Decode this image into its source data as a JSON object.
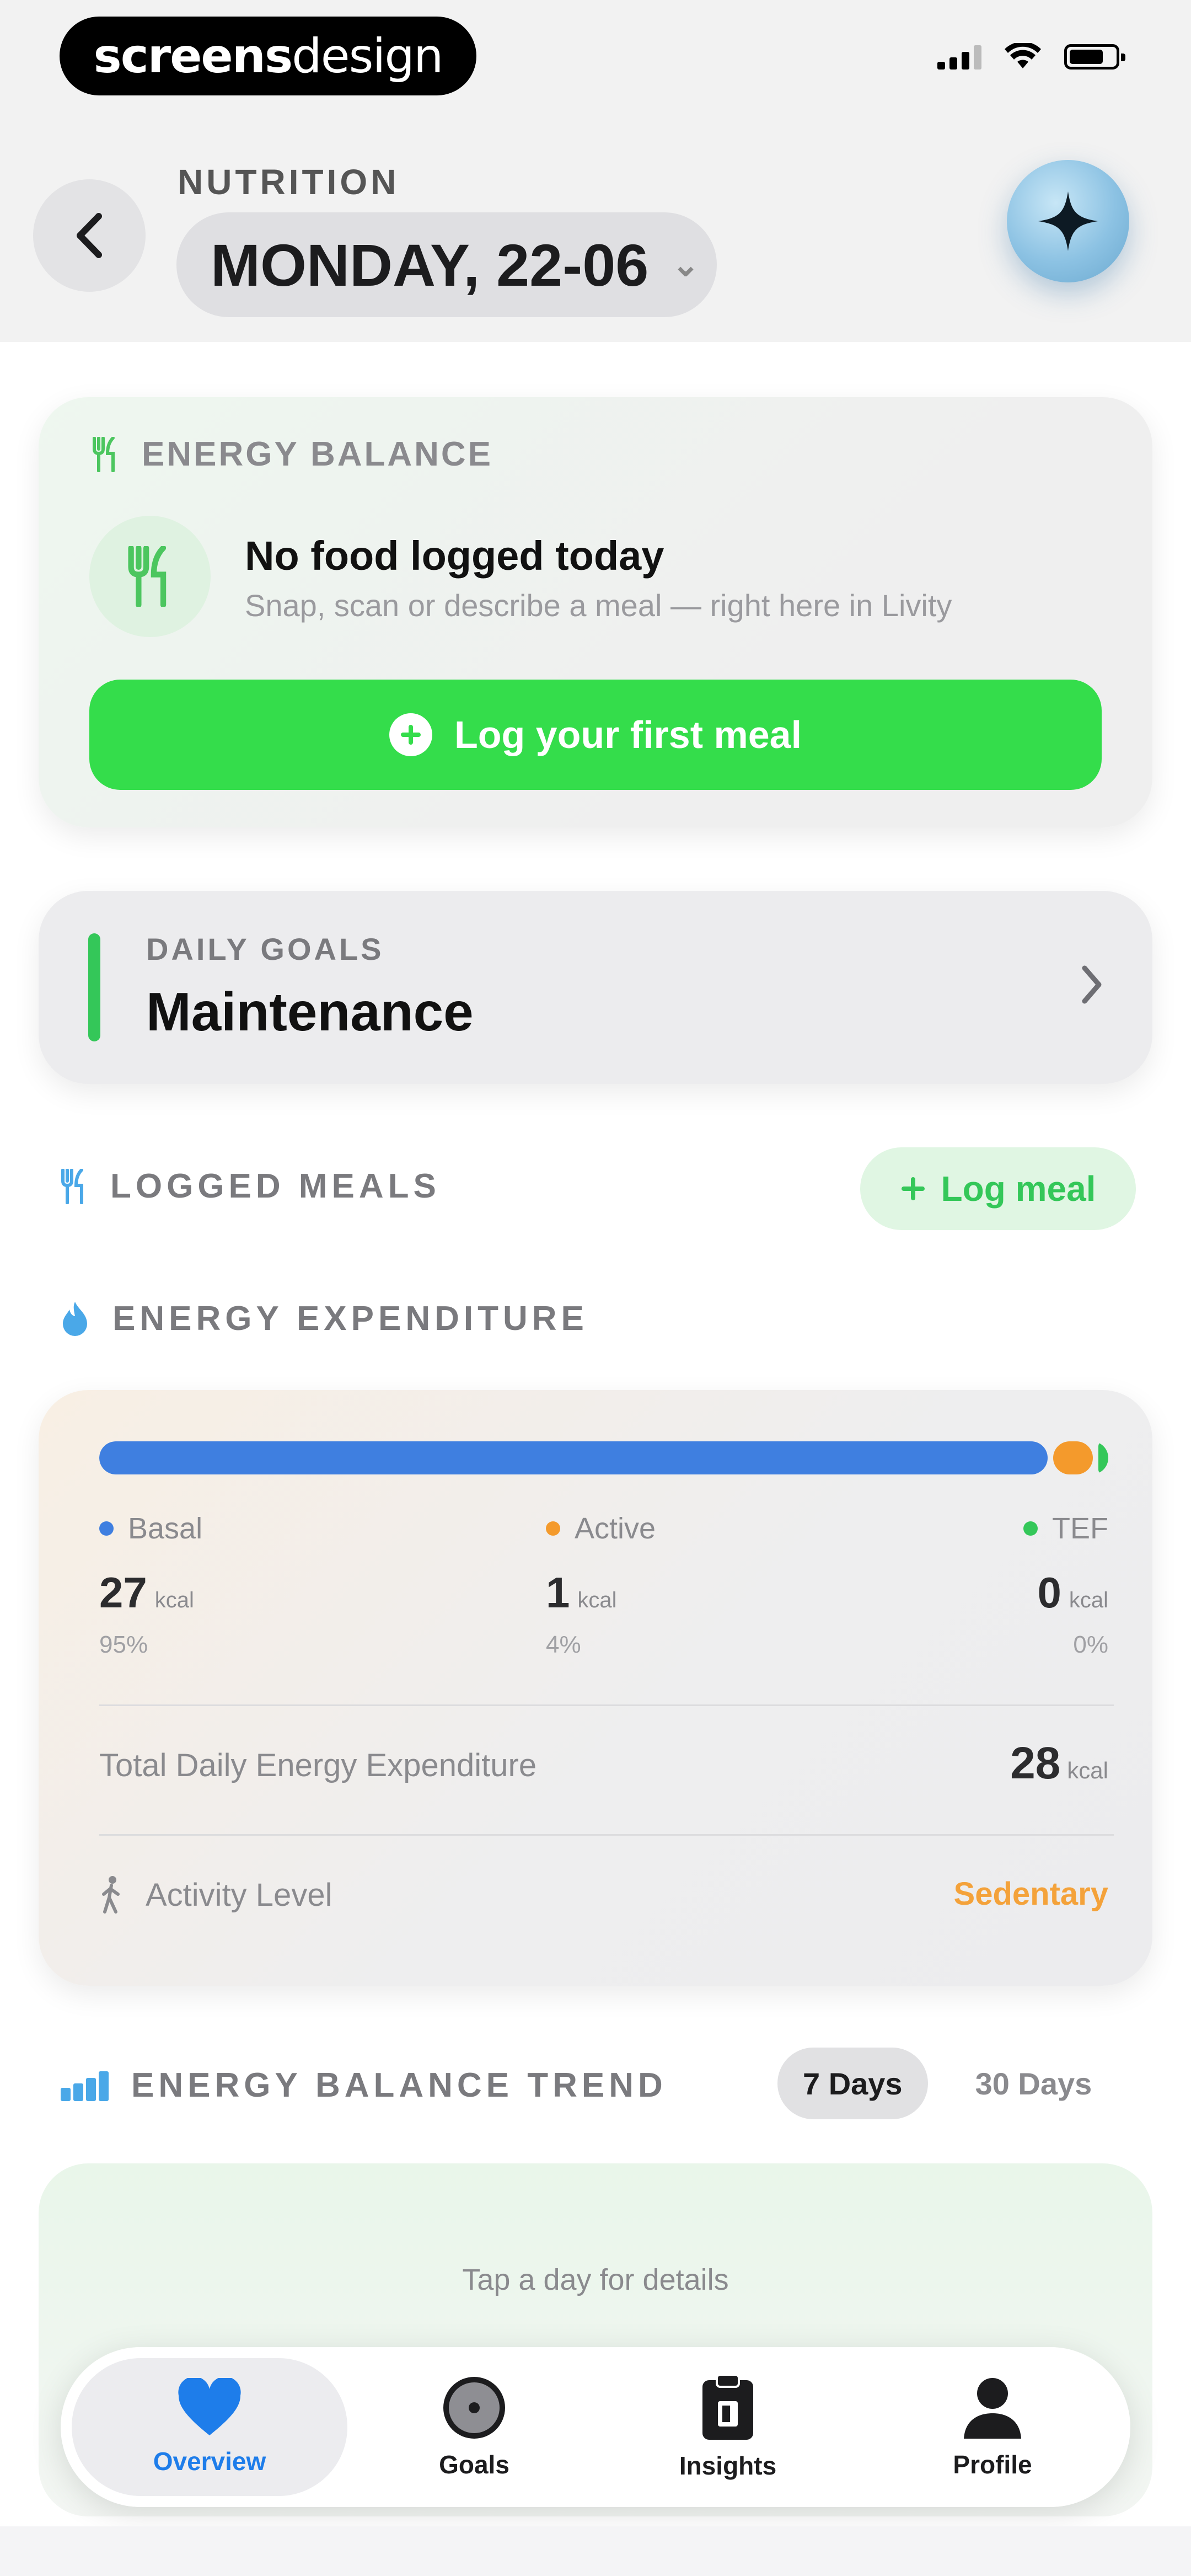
{
  "status_bar": {
    "brand_bold": "screens",
    "brand_light": "design"
  },
  "header": {
    "subtitle": "NUTRITION",
    "date": "MONDAY, 22-06"
  },
  "energy_balance": {
    "label": "ENERGY BALANCE",
    "title": "No food logged today",
    "subtitle": "Snap, scan or describe a meal — right here in Livity",
    "button_label": "Log your first meal"
  },
  "daily_goals": {
    "label": "DAILY GOALS",
    "value": "Maintenance"
  },
  "logged_meals": {
    "label": "LOGGED MEALS",
    "button_label": "Log meal"
  },
  "energy_expenditure": {
    "label": "ENERGY EXPENDITURE",
    "colors": {
      "basal": "#3f7fe0",
      "active": "#f49a2c",
      "tef": "#34c759"
    },
    "shares": {
      "basal": 95,
      "active": 4,
      "tef": 1
    },
    "basal": {
      "name": "Basal",
      "value": "27",
      "unit": "kcal",
      "pct": "95%"
    },
    "active": {
      "name": "Active",
      "value": "1",
      "unit": "kcal",
      "pct": "4%"
    },
    "tef": {
      "name": "TEF",
      "value": "0",
      "unit": "kcal",
      "pct": "0%"
    },
    "tdee_label": "Total Daily Energy Expenditure",
    "tdee_value": "28",
    "tdee_unit": "kcal",
    "activity_label": "Activity Level",
    "activity_value": "Sedentary"
  },
  "trend": {
    "label": "ENERGY BALANCE TREND",
    "options": [
      "7 Days",
      "30 Days"
    ],
    "selected": "7 Days",
    "hint": "Tap a day for details"
  },
  "tabs": [
    {
      "label": "Overview",
      "icon": "heart-icon",
      "active": true
    },
    {
      "label": "Goals",
      "icon": "target-icon",
      "active": false
    },
    {
      "label": "Insights",
      "icon": "clipboard-icon",
      "active": false
    },
    {
      "label": "Profile",
      "icon": "person-icon",
      "active": false
    }
  ]
}
